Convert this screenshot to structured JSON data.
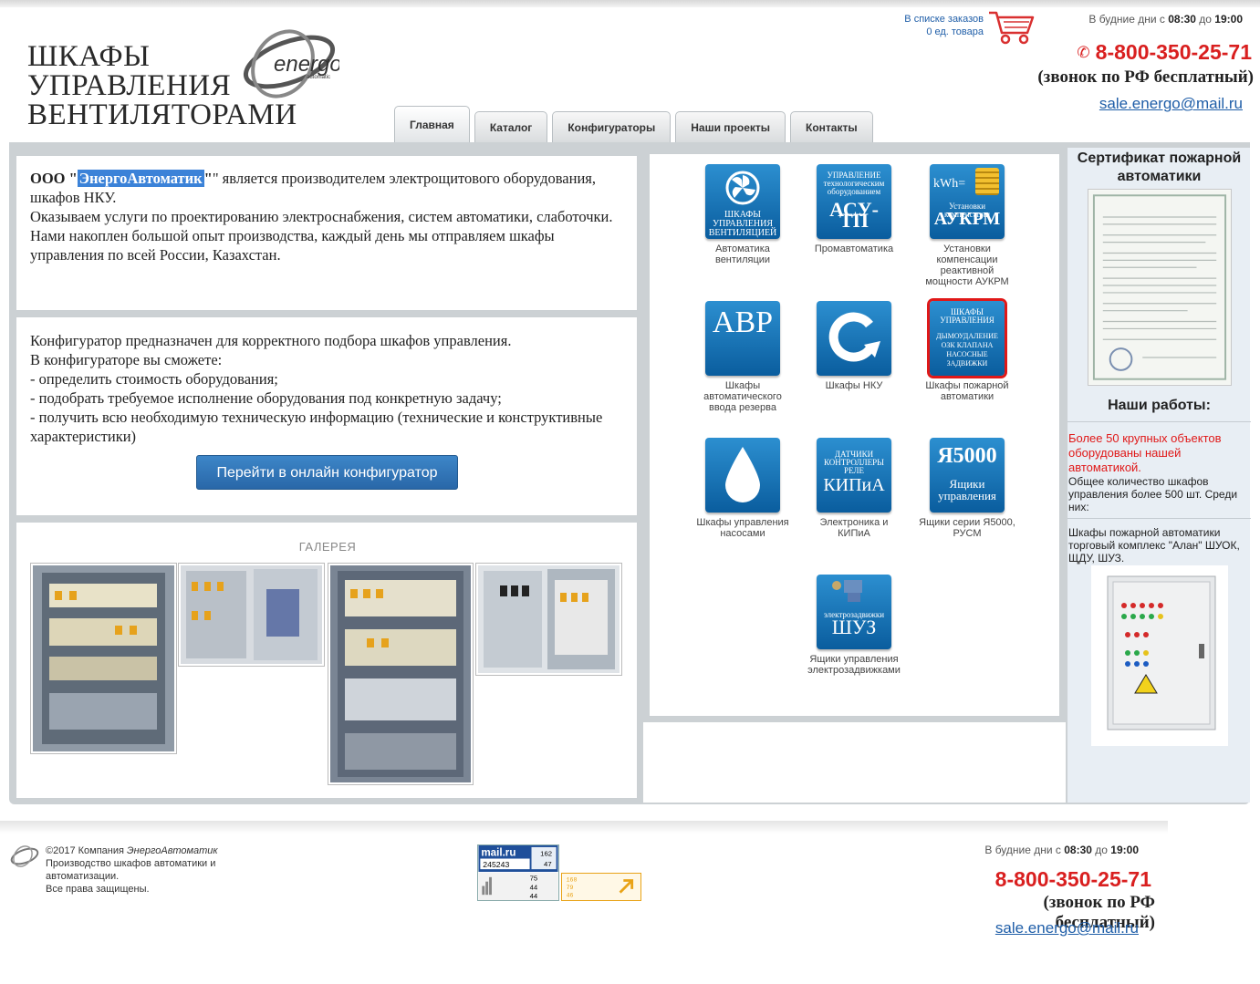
{
  "header": {
    "logo_lines": [
      "ШКАФЫ",
      "УПРАВЛЕНИЯ",
      "ВЕНТИЛЯТОРАМИ"
    ],
    "brand_word": "energo",
    "brand_sub": "automatic",
    "cart_line1": "В списке заказов",
    "cart_line2": "0 ед. товара",
    "hours_prefix": "В будние дни с ",
    "hours_from": "08:30",
    "hours_mid": " до ",
    "hours_to": "19:00",
    "phone": "8-800-350-25-71",
    "free_call": "(звонок по РФ бесплатный)",
    "email": "sale.energo@mail.ru"
  },
  "nav": {
    "tabs": [
      "Главная",
      "Каталог",
      "Конфигураторы",
      "Наши проекты",
      "Контакты"
    ],
    "active": "Главная"
  },
  "intro": {
    "prefix": "ООО \"",
    "company": "ЭнергоАвтоматик",
    "suffix": "\" является производителем электрощитового оборудования, шкафов НКУ.",
    "line2": "Оказываем услуги по проектированию электроснабжения, систем автоматики, слаботочки.",
    "line3": "Нами накоплен большой опыт производства, каждый день мы отправляем шкафы управления по всей России, Казахстан."
  },
  "configurator": {
    "line1": "Конфигуратор предназначен для корректного подбора шкафов управления.",
    "line2": "В конфигураторе вы сможете:",
    "line3": "- определить стоимость оборудования;",
    "line4": "- подобрать требуемое исполнение оборудования под конкретную задачу;",
    "line5": "- получить всю необходимую техническую информацию (технические и конструктивные характеристики)",
    "button": "Перейти в онлайн конфигуратор"
  },
  "gallery": {
    "title": "ГАЛЕРЕЯ"
  },
  "categories": [
    {
      "icon": "fan-icon",
      "icon_text": "ШКАФЫ УПРАВЛЕНИЯ ВЕНТИЛЯЦИЕЙ",
      "label": "Автоматика вентиляции"
    },
    {
      "icon": "asutp-icon",
      "icon_text": "УПРАВЛЕНИЕ технологическим оборудованием",
      "icon_big": "АСУ-ТП",
      "label": "Промавтоматика"
    },
    {
      "icon": "kwh-icon",
      "icon_text": "Установки компенсации",
      "icon_big": "АУКРМ",
      "icon_top": "kWh=",
      "label": "Установки компенсации реактивной мощности АУКРМ"
    },
    {
      "icon": "avr-icon",
      "icon_big": "АВР",
      "label": "Шкафы автоматического ввода резерва"
    },
    {
      "icon": "nku-icon",
      "label": "Шкафы НКУ"
    },
    {
      "icon": "fire-panel-icon",
      "icon_text": "ШКАФЫ УПРАВЛЕНИЯ",
      "icon_text2": "ДЫМОУДАЛЕНИЕ ОЗК КЛАПАНА НАСОСНЫЕ ЗАДВИЖКИ",
      "label": "Шкафы пожарной автоматики"
    },
    {
      "icon": "water-drop-icon",
      "label": "Шкафы управления насосами"
    },
    {
      "icon": "kip-icon",
      "icon_text": "ДАТЧИКИ КОНТРОЛЛЕРЫ РЕЛЕ",
      "icon_big": "КИПиА",
      "label": "Электроника и КИПиА"
    },
    {
      "icon": "ya5000-icon",
      "icon_big": "Я5000",
      "icon_text": "Ящики управления",
      "label": "Ящики серии Я5000, РУСМ"
    },
    {
      "icon": "valve-icon",
      "icon_text": "электрозадвижки",
      "icon_big": "ШУЗ",
      "label": "Ящики управления электрозадвижками"
    }
  ],
  "sidebar": {
    "cert_title": "Сертификат пожарной автоматики",
    "works_title": "Наши работы:",
    "works_red": "Более 50 крупных объектов оборудованы нашей автоматикой.",
    "works_text": "Общее количество шкафов управления более 500 шт. Среди них:",
    "project_text": "Шкафы пожарной автоматики торговый комплекс \"Алан\" ШУОК, ЩДУ, ШУЗ."
  },
  "footer": {
    "copyright_prefix": "©2017 Компания ",
    "company": "ЭнергоАвтоматик",
    "line2": "Производство шкафов автоматики и автоматизации.",
    "line3": "Все права защищены.",
    "counter_brand": "mail.ru",
    "counter_main": "245243",
    "counter_top": "162",
    "counter_top2": "47",
    "counter_v1": "75",
    "counter_v2": "44",
    "counter_v3": "44",
    "counter2_v1": "168",
    "counter2_v2": "79",
    "counter2_v3": "46"
  },
  "colors": {
    "accent_blue": "#1f5ea8",
    "phone_red": "#d91f1f",
    "tile_blue": "#0a6cb0",
    "frame_gray": "#ccd1d4"
  }
}
